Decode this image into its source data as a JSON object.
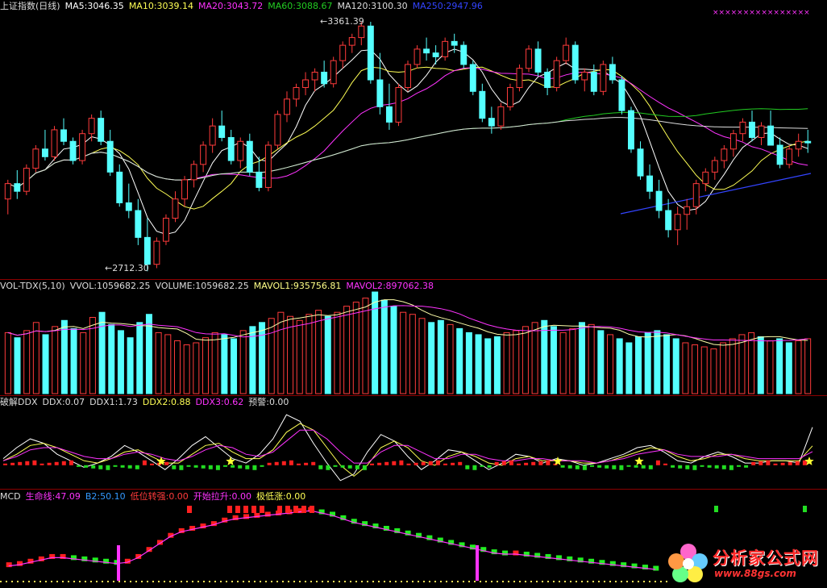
{
  "colors": {
    "up": "#ff3b3b",
    "down": "#55ffff",
    "ma5": "#ffffff",
    "ma10": "#ffff55",
    "ma20": "#ff33ff",
    "ma60": "#22cc22",
    "ma120": "#dddddd",
    "ma250": "#3344ff",
    "divider": "#8b0000"
  },
  "header_main": [
    {
      "text": "上证指数(日线)",
      "color": "#dddddd"
    },
    {
      "text": "MA5:3046.35",
      "color": "#ffffff"
    },
    {
      "text": "MA10:3039.14",
      "color": "#ffff55"
    },
    {
      "text": "MA20:3043.72",
      "color": "#ff33ff"
    },
    {
      "text": "MA60:3088.67",
      "color": "#22cc22"
    },
    {
      "text": "MA120:3100.30",
      "color": "#dddddd"
    },
    {
      "text": "MA250:2947.96",
      "color": "#3344ff"
    }
  ],
  "header_vol": [
    {
      "text": "VOL-TDX(5,10)",
      "color": "#dddddd"
    },
    {
      "text": "VVOL:1059682.25",
      "color": "#dddddd"
    },
    {
      "text": "VOLUME:1059682.25",
      "color": "#dddddd"
    },
    {
      "text": "MAVOL1:935756.81",
      "color": "#ffff88"
    },
    {
      "text": "MAVOL2:897062.38",
      "color": "#ff33ff"
    }
  ],
  "header_ddx": [
    {
      "text": "破解DDX",
      "color": "#dddddd"
    },
    {
      "text": "DDX:0.07",
      "color": "#dddddd"
    },
    {
      "text": "DDX1:1.73",
      "color": "#dddddd"
    },
    {
      "text": "DDX2:0.88",
      "color": "#ffff55"
    },
    {
      "text": "DDX3:0.62",
      "color": "#ff33ff"
    },
    {
      "text": "预警:0.00",
      "color": "#dddddd"
    }
  ],
  "header_mcd": [
    {
      "text": "MCD",
      "color": "#dddddd"
    },
    {
      "text": "生命线:47.09",
      "color": "#ff33ff"
    },
    {
      "text": "B2:50.10",
      "color": "#3399ff"
    },
    {
      "text": "低位转强:0.00",
      "color": "#ff3b3b"
    },
    {
      "text": "开始拉升:0.00",
      "color": "#ff33ff"
    },
    {
      "text": "极低涨:0.00",
      "color": "#ffff55"
    }
  ],
  "annotations": {
    "high_label": "3361.39",
    "low_label": "2712.30",
    "markers": "××××××××××××××××"
  },
  "logo": {
    "text": "分析家公式网",
    "url": "www.88gs.com"
  },
  "chart_data": [
    {
      "type": "candlestick",
      "title": "上证指数(日线)",
      "panel": "price",
      "ylim": [
        2700,
        3380
      ],
      "high": 3361.39,
      "low": 2712.3,
      "candles": [
        [
          2900,
          2950,
          2860,
          2940
        ],
        [
          2940,
          2975,
          2900,
          2920
        ],
        [
          2920,
          2990,
          2910,
          2980
        ],
        [
          2980,
          3040,
          2970,
          3030
        ],
        [
          3030,
          3080,
          3000,
          3010
        ],
        [
          3010,
          3090,
          3000,
          3080
        ],
        [
          3080,
          3110,
          3040,
          3050
        ],
        [
          3050,
          3060,
          2990,
          3000
        ],
        [
          3000,
          3080,
          2990,
          3070
        ],
        [
          3070,
          3120,
          3050,
          3110
        ],
        [
          3110,
          3130,
          3040,
          3050
        ],
        [
          3050,
          3080,
          2960,
          2970
        ],
        [
          2970,
          2990,
          2880,
          2890
        ],
        [
          2890,
          2940,
          2850,
          2870
        ],
        [
          2870,
          2900,
          2780,
          2800
        ],
        [
          2800,
          2850,
          2712,
          2730
        ],
        [
          2730,
          2800,
          2720,
          2790
        ],
        [
          2790,
          2860,
          2780,
          2850
        ],
        [
          2850,
          2920,
          2840,
          2900
        ],
        [
          2900,
          2960,
          2880,
          2950
        ],
        [
          2950,
          3000,
          2930,
          2990
        ],
        [
          2990,
          3050,
          2970,
          3040
        ],
        [
          3040,
          3110,
          3020,
          3090
        ],
        [
          3090,
          3130,
          3050,
          3060
        ],
        [
          3060,
          3080,
          2990,
          3000
        ],
        [
          3000,
          3060,
          2980,
          3050
        ],
        [
          3050,
          3070,
          2960,
          2970
        ],
        [
          2970,
          3010,
          2920,
          2930
        ],
        [
          2930,
          3050,
          2920,
          3040
        ],
        [
          3040,
          3130,
          3030,
          3120
        ],
        [
          3120,
          3180,
          3100,
          3160
        ],
        [
          3160,
          3200,
          3140,
          3190
        ],
        [
          3190,
          3230,
          3170,
          3210
        ],
        [
          3210,
          3240,
          3180,
          3230
        ],
        [
          3230,
          3260,
          3190,
          3200
        ],
        [
          3200,
          3270,
          3190,
          3260
        ],
        [
          3260,
          3310,
          3240,
          3300
        ],
        [
          3300,
          3330,
          3280,
          3320
        ],
        [
          3320,
          3361,
          3300,
          3350
        ],
        [
          3350,
          3361,
          3200,
          3210
        ],
        [
          3210,
          3280,
          3120,
          3140
        ],
        [
          3140,
          3200,
          3080,
          3100
        ],
        [
          3100,
          3200,
          3090,
          3190
        ],
        [
          3190,
          3260,
          3180,
          3250
        ],
        [
          3250,
          3300,
          3240,
          3290
        ],
        [
          3290,
          3320,
          3260,
          3280
        ],
        [
          3280,
          3300,
          3250,
          3270
        ],
        [
          3270,
          3320,
          3260,
          3310
        ],
        [
          3310,
          3330,
          3280,
          3300
        ],
        [
          3300,
          3310,
          3240,
          3250
        ],
        [
          3250,
          3260,
          3170,
          3180
        ],
        [
          3180,
          3200,
          3100,
          3110
        ],
        [
          3110,
          3140,
          3070,
          3090
        ],
        [
          3090,
          3150,
          3080,
          3140
        ],
        [
          3140,
          3200,
          3130,
          3190
        ],
        [
          3190,
          3250,
          3180,
          3240
        ],
        [
          3240,
          3300,
          3230,
          3290
        ],
        [
          3290,
          3310,
          3220,
          3230
        ],
        [
          3230,
          3240,
          3170,
          3190
        ],
        [
          3190,
          3270,
          3180,
          3260
        ],
        [
          3260,
          3320,
          3250,
          3300
        ],
        [
          3300,
          3310,
          3200,
          3210
        ],
        [
          3210,
          3240,
          3180,
          3230
        ],
        [
          3230,
          3250,
          3170,
          3180
        ],
        [
          3180,
          3260,
          3170,
          3250
        ],
        [
          3250,
          3270,
          3200,
          3210
        ],
        [
          3210,
          3220,
          3120,
          3130
        ],
        [
          3130,
          3140,
          3020,
          3030
        ],
        [
          3030,
          3050,
          2950,
          2960
        ],
        [
          2960,
          2990,
          2900,
          2920
        ],
        [
          2920,
          2950,
          2850,
          2870
        ],
        [
          2870,
          2900,
          2800,
          2820
        ],
        [
          2820,
          2880,
          2780,
          2860
        ],
        [
          2860,
          2900,
          2820,
          2880
        ],
        [
          2880,
          2950,
          2860,
          2940
        ],
        [
          2940,
          2980,
          2920,
          2970
        ],
        [
          2970,
          3010,
          2950,
          3000
        ],
        [
          3000,
          3040,
          2980,
          3030
        ],
        [
          3030,
          3080,
          3010,
          3070
        ],
        [
          3070,
          3110,
          3050,
          3100
        ],
        [
          3100,
          3130,
          3050,
          3060
        ],
        [
          3060,
          3100,
          3040,
          3090
        ],
        [
          3090,
          3130,
          3070,
          3040
        ],
        [
          3040,
          3060,
          2980,
          2990
        ],
        [
          2990,
          3040,
          2980,
          3030
        ],
        [
          3030,
          3070,
          3010,
          3050
        ],
        [
          3050,
          3080,
          3020,
          3046
        ]
      ]
    },
    {
      "type": "bar",
      "panel": "volume",
      "title": "VOL-TDX(5,10)",
      "values": [
        60,
        55,
        62,
        70,
        58,
        66,
        72,
        64,
        60,
        75,
        80,
        68,
        62,
        55,
        70,
        78,
        60,
        58,
        52,
        48,
        50,
        55,
        60,
        58,
        54,
        62,
        66,
        70,
        74,
        80,
        76,
        72,
        78,
        82,
        76,
        80,
        86,
        90,
        94,
        100,
        92,
        86,
        80,
        78,
        74,
        70,
        72,
        68,
        64,
        60,
        58,
        54,
        56,
        60,
        62,
        66,
        70,
        72,
        66,
        60,
        64,
        70,
        68,
        62,
        58,
        54,
        50,
        56,
        60,
        62,
        58,
        54,
        50,
        48,
        46,
        44,
        50,
        54,
        58,
        60,
        56,
        52,
        54,
        50,
        52,
        54
      ]
    },
    {
      "type": "line",
      "panel": "ddx",
      "title": "破解DDX",
      "series": [
        {
          "name": "DDX1",
          "values": [
            0.3,
            0.8,
            1.2,
            1.0,
            0.5,
            0.2,
            -0.1,
            0.1,
            0.4,
            0.9,
            0.6,
            0.2,
            -0.2,
            0.3,
            0.9,
            1.3,
            0.8,
            0.3,
            0.1,
            0.5,
            1.2,
            2.3,
            2.0,
            1.0,
            0.1,
            -0.7,
            -0.4,
            0.6,
            1.4,
            1.1,
            0.4,
            -0.2,
            0.2,
            0.7,
            0.6,
            0.2,
            -0.2,
            0.1,
            0.5,
            0.4,
            0.1,
            0.3,
            0.2,
            0.0,
            0.1,
            0.3,
            0.5,
            0.8,
            0.9,
            0.6,
            0.2,
            0.1,
            0.4,
            0.6,
            0.4,
            0.1,
            0.1,
            0.2,
            0.2,
            0.1,
            1.73
          ]
        },
        {
          "name": "DDX2",
          "values": [
            0.2,
            0.5,
            0.9,
            1.0,
            0.8,
            0.5,
            0.2,
            0.1,
            0.3,
            0.6,
            0.7,
            0.4,
            0.1,
            0.1,
            0.5,
            0.9,
            1.0,
            0.6,
            0.3,
            0.3,
            0.7,
            1.5,
            1.9,
            1.6,
            0.8,
            0.0,
            -0.5,
            0.0,
            0.8,
            1.1,
            0.8,
            0.2,
            0.0,
            0.4,
            0.6,
            0.4,
            0.1,
            0.0,
            0.3,
            0.4,
            0.2,
            0.2,
            0.2,
            0.1,
            0.1,
            0.2,
            0.4,
            0.6,
            0.8,
            0.7,
            0.4,
            0.2,
            0.3,
            0.5,
            0.5,
            0.3,
            0.2,
            0.2,
            0.2,
            0.2,
            0.88
          ]
        },
        {
          "name": "DDX3",
          "values": [
            0.2,
            0.4,
            0.7,
            0.8,
            0.8,
            0.6,
            0.4,
            0.3,
            0.3,
            0.5,
            0.6,
            0.5,
            0.3,
            0.2,
            0.4,
            0.7,
            0.9,
            0.8,
            0.5,
            0.4,
            0.6,
            1.1,
            1.6,
            1.6,
            1.2,
            0.6,
            0.1,
            0.1,
            0.6,
            0.9,
            0.9,
            0.6,
            0.3,
            0.3,
            0.5,
            0.5,
            0.3,
            0.2,
            0.2,
            0.3,
            0.3,
            0.2,
            0.2,
            0.2,
            0.1,
            0.2,
            0.3,
            0.5,
            0.6,
            0.7,
            0.5,
            0.4,
            0.4,
            0.4,
            0.5,
            0.4,
            0.3,
            0.3,
            0.3,
            0.3,
            0.62
          ]
        }
      ],
      "ylim": [
        -1.0,
        2.6
      ]
    },
    {
      "type": "bar",
      "panel": "mcd",
      "title": "MCD",
      "values": [
        15,
        16,
        18,
        20,
        22,
        22,
        21,
        20,
        19,
        18,
        17,
        18,
        22,
        28,
        34,
        40,
        44,
        46,
        48,
        50,
        53,
        55,
        56,
        57,
        58,
        59,
        60,
        61,
        62,
        60,
        58,
        55,
        52,
        50,
        48,
        46,
        44,
        42,
        40,
        38,
        36,
        34,
        32,
        30,
        28,
        26,
        25,
        25,
        24,
        23,
        22,
        21,
        20,
        19,
        18,
        17,
        16,
        15,
        14,
        13,
        12
      ]
    }
  ]
}
